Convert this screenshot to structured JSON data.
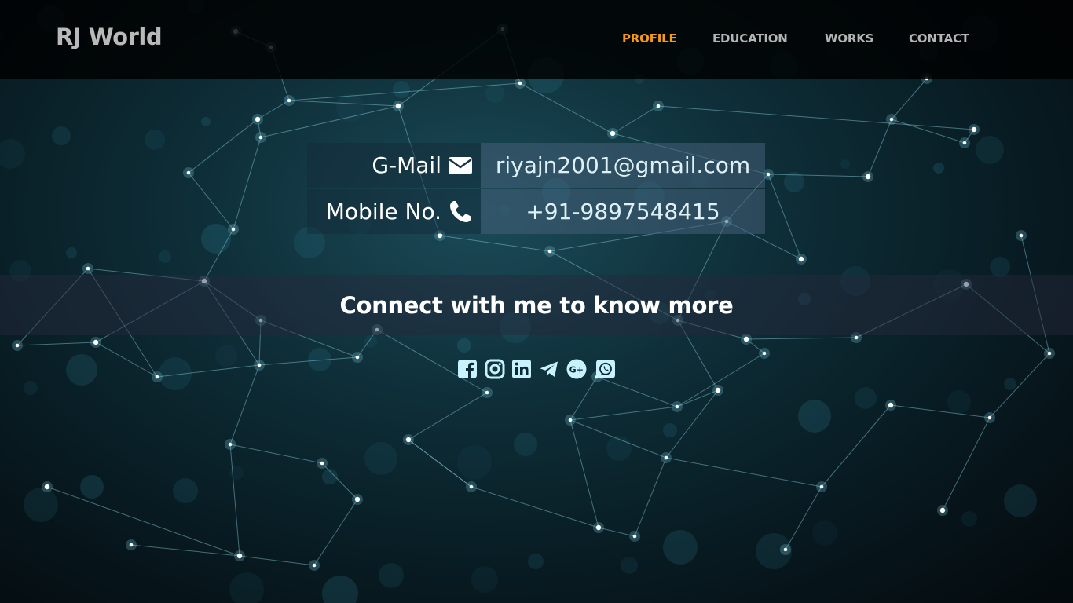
{
  "brand": "RJ World",
  "nav": {
    "profile": "PROFILE",
    "education": "EDUCATION",
    "works": "WORKS",
    "contact": "CONTACT"
  },
  "contact": {
    "gmail_label": "G-Mail",
    "gmail_value": "riyajn2001@gmail.com",
    "mobile_label": "Mobile No.",
    "mobile_value": "+91-9897548415"
  },
  "connect_text": "Connect with me to know more",
  "icons": {
    "gmail": "envelope-icon",
    "mobile": "phone-icon",
    "social": [
      "facebook-icon",
      "instagram-icon",
      "linkedin-icon",
      "telegram-icon",
      "google-plus-icon",
      "whatsapp-icon"
    ]
  },
  "colors": {
    "nav_active": "#f59b17",
    "nav_inactive": "#b4b4b4",
    "brand": "#b9b9b9",
    "social_icon": "#c9f2ff"
  }
}
